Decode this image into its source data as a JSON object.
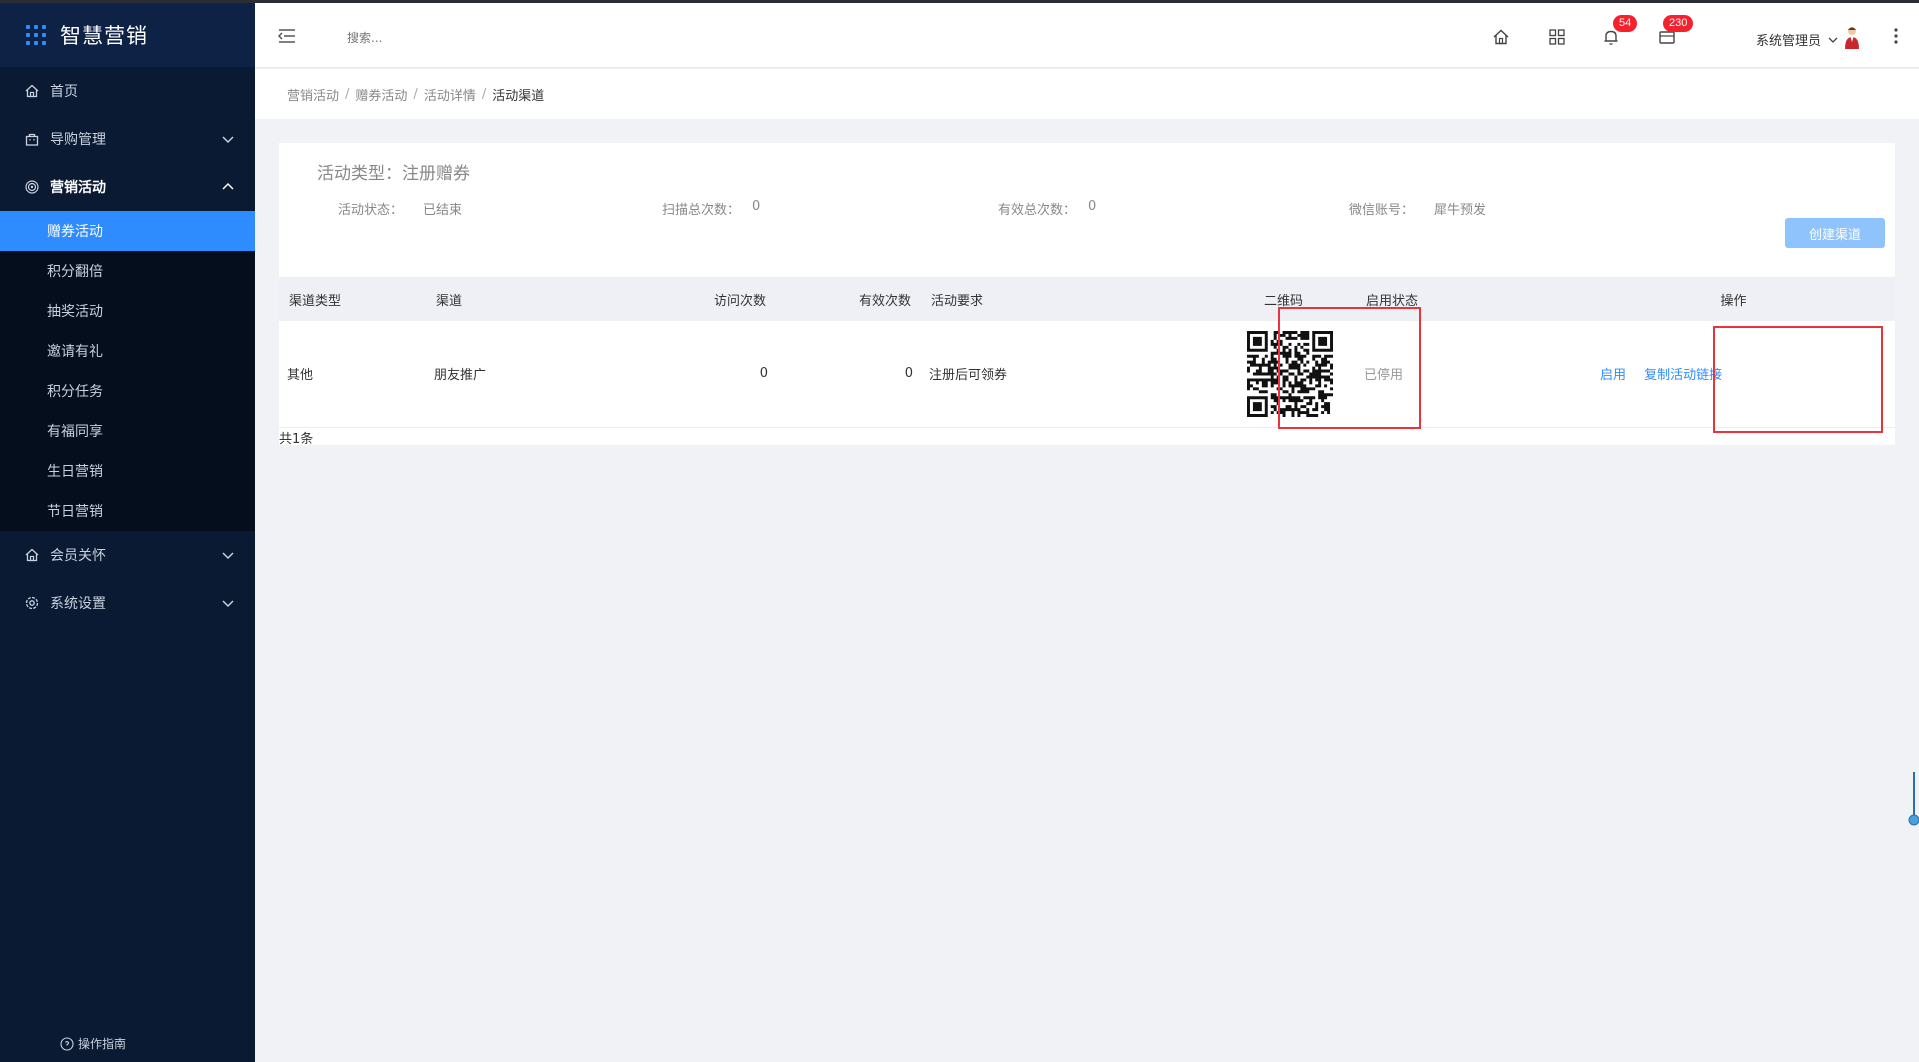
{
  "app": {
    "title": "智慧营销"
  },
  "sidebar": {
    "items": [
      {
        "label": "首页",
        "icon": "home-icon"
      },
      {
        "label": "导购管理",
        "icon": "bag-icon"
      },
      {
        "label": "营销活动",
        "icon": "target-icon"
      },
      {
        "label": "会员关怀",
        "icon": "home-icon"
      },
      {
        "label": "系统设置",
        "icon": "gear-icon"
      }
    ],
    "sub_items": [
      {
        "label": "赠券活动"
      },
      {
        "label": "积分翻倍"
      },
      {
        "label": "抽奖活动"
      },
      {
        "label": "邀请有礼"
      },
      {
        "label": "积分任务"
      },
      {
        "label": "有福同享"
      },
      {
        "label": "生日营销"
      },
      {
        "label": "节日营销"
      }
    ],
    "guide": "操作指南"
  },
  "header": {
    "search_placeholder": "搜索...",
    "notifications_badge": "54",
    "messages_badge": "230",
    "user_name": "系统管理员"
  },
  "breadcrumb": {
    "items": [
      "营销活动",
      "赠券活动",
      "活动详情"
    ],
    "current": "活动渠道"
  },
  "card": {
    "title": "活动类型：注册赠券",
    "stats": [
      {
        "key": "活动状态：",
        "value": "已结束"
      },
      {
        "key": "扫描总次数：",
        "value": "0"
      },
      {
        "key": "有效总次数：",
        "value": "0"
      },
      {
        "key": "微信账号：",
        "value": "犀牛预发"
      }
    ],
    "create_label": "创建渠道"
  },
  "table": {
    "headers": [
      "渠道类型",
      "渠道",
      "访问次数",
      "有效次数",
      "活动要求",
      "二维码",
      "启用状态",
      "操作"
    ],
    "rows": [
      {
        "type": "其他",
        "channel": "朋友推广",
        "visits": "0",
        "valid": "0",
        "requirement": "注册后可领券",
        "status": "已停用",
        "action_enable": "启用",
        "action_copy": "复制活动链接"
      }
    ],
    "total": "共1条"
  },
  "colors": {
    "accent": "#2f8cff",
    "sidebar": "#0b1a33",
    "highlight": "#e8353b",
    "badge": "#f5222d"
  }
}
